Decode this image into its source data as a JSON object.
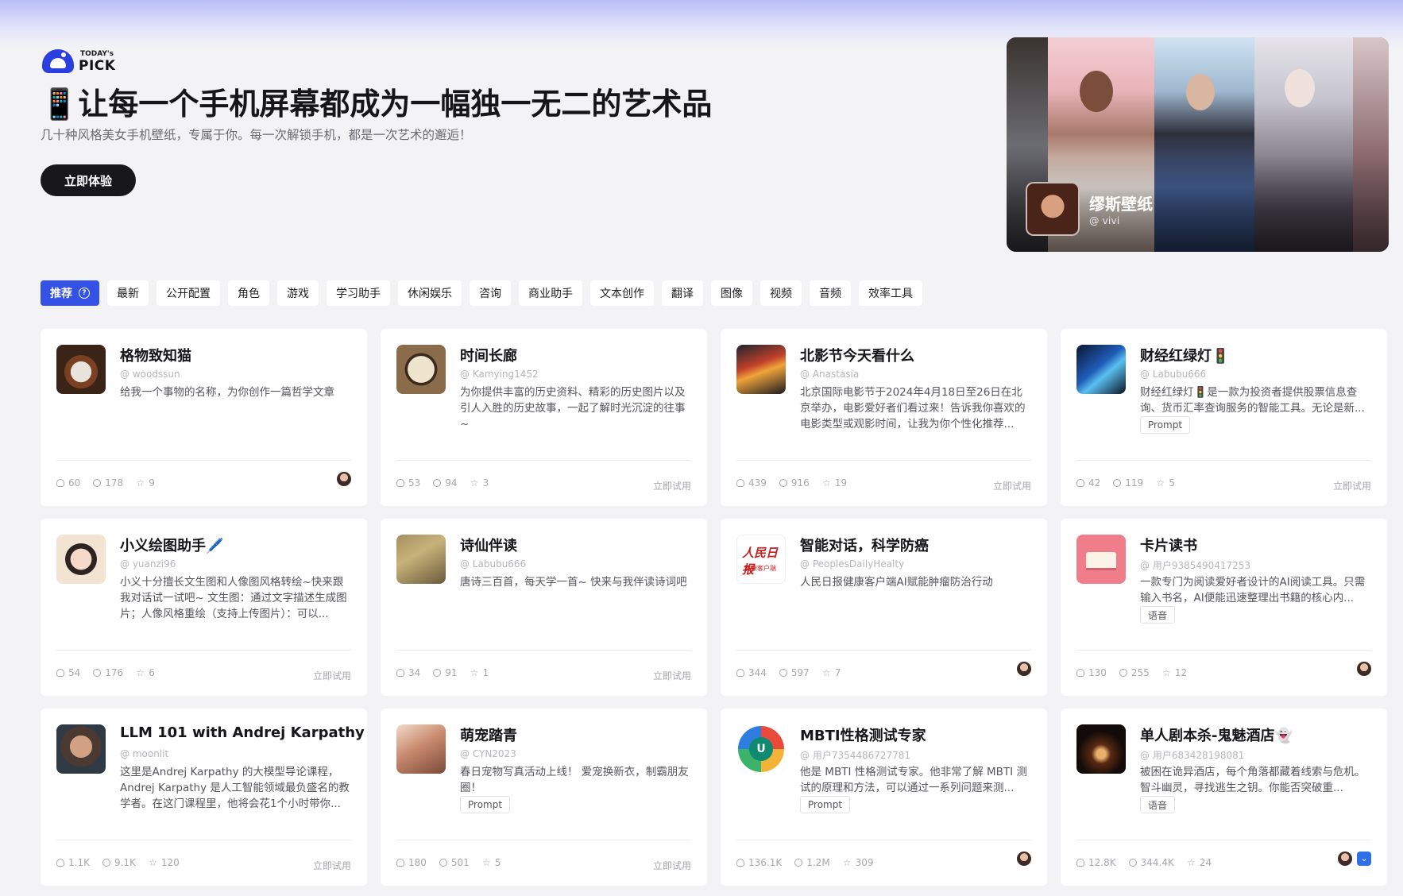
{
  "brand": {
    "logo_line1": "TODAY's",
    "logo_line2": "PICK"
  },
  "hero": {
    "title": "📱让每一个手机屏幕都成为一幅独一无二的艺术品",
    "subtitle": "几十种风格美女手机壁纸，专属于你。每一次解锁手机，都是一次艺术的邂逅！",
    "cta": "立即体验"
  },
  "banner": {
    "title": "缪斯壁纸",
    "author": "@ vivi"
  },
  "tabs": [
    "推荐",
    "最新",
    "公开配置",
    "角色",
    "游戏",
    "学习助手",
    "休闲娱乐",
    "咨询",
    "商业助手",
    "文本创作",
    "翻译",
    "图像",
    "视频",
    "音频",
    "效率工具"
  ],
  "try_label": "立即试用",
  "cards": [
    {
      "title": "格物致知猫",
      "author": "@ woodssun",
      "desc": "给我一个事物的名称，为你创作一篇哲学文章",
      "users": "60",
      "comments": "178",
      "stars": "9",
      "thumb_icon": "cat-icon"
    },
    {
      "title": "时间长廊",
      "author": "@ Kamying1452",
      "desc": "为你提供丰富的历史资料、精彩的历史图片以及引人入胜的历史故事，一起了解时光沉淀的往事~",
      "users": "53",
      "comments": "94",
      "stars": "3",
      "thumb_icon": "clock-icon"
    },
    {
      "title": "北影节今天看什么",
      "author": "@ Anastasia",
      "desc": "北京国际电影节于2024年4月18日至26日在北京举办，电影爱好者们看过来！告诉我你喜欢的电影类型或观影时间，让我为你个性化推荐...",
      "users": "439",
      "comments": "916",
      "stars": "19",
      "thumb_icon": "film-icon"
    },
    {
      "title": "财经红绿灯🚦",
      "author": "@ Labubu666",
      "desc": "财经红绿灯🚦是一款为投资者提供股票信息查询、货币汇率查询服务的智能工具。无论是新...",
      "tag": "Prompt",
      "users": "42",
      "comments": "119",
      "stars": "5",
      "thumb_icon": "finance-icon"
    },
    {
      "title": "小义绘图助手🖊️",
      "author": "@ yuanzi96",
      "desc": "小义十分擅长文生图和人像图风格转绘~快来跟我对话试一试吧~ 文生图：通过文字描述生成图片；人像风格重绘（支持上传图片）：可以...",
      "users": "54",
      "comments": "176",
      "stars": "6",
      "thumb_icon": "girl-icon"
    },
    {
      "title": "诗仙伴读",
      "author": "@ Labubu666",
      "desc": "唐诗三百首，每天学一首~ 快来与我伴读诗词吧",
      "users": "34",
      "comments": "91",
      "stars": "1",
      "thumb_icon": "poet-icon"
    },
    {
      "title": "智能对话，科学防癌",
      "author": "@ PeoplesDailyHealty",
      "desc": "人民日报健康客户端AI赋能肿瘤防治行动",
      "users": "344",
      "comments": "597",
      "stars": "7",
      "thumb_icon": "rmrb-logo-icon",
      "thumb_text1": "人民日报",
      "thumb_text2": "健康客户端"
    },
    {
      "title": "卡片读书",
      "author": "@ 用户9385490417253",
      "desc": "一款专门为阅读爱好者设计的AI阅读工具。只需输入书名，AI便能迅速整理出书籍的核心内...",
      "tag": "语音",
      "users": "130",
      "comments": "255",
      "stars": "12",
      "thumb_icon": "book-icon"
    },
    {
      "title": "LLM 101 with Andrej Karpathy",
      "author": "@ moonlit",
      "desc": "这里是Andrej Karpathy 的大模型导论课程，Andrej Karpathy 是人工智能领域最负盛名的教学者。在这门课程里，他将会花1个小时带你...",
      "users": "1.1K",
      "comments": "9.1K",
      "stars": "120",
      "thumb_icon": "karpathy-icon"
    },
    {
      "title": "萌宠踏青",
      "author": "@ CYN2023",
      "desc": "春日宠物写真活动上线！ 爱宠换新衣，制霸朋友圈！",
      "tag": "Prompt",
      "users": "180",
      "comments": "501",
      "stars": "5",
      "thumb_icon": "pet-icon"
    },
    {
      "title": "MBTI性格测试专家",
      "author": "@ 用户7354486727781",
      "desc": "他是 MBTI 性格测试专家。他非常了解 MBTI 测试的原理和方法，可以通过一系列问题来测...",
      "tag": "Prompt",
      "users": "136.1K",
      "comments": "1.2M",
      "stars": "309",
      "thumb_icon": "mbti-icon",
      "thumb_text1": "U"
    },
    {
      "title": "单人剧本杀-鬼魅酒店👻",
      "author": "@ 用户6834281980​81",
      "desc": "被困在诡异酒店，每个角落都藏着线索与危机。智斗幽灵，寻找逃生之钥。你能否突破重...",
      "tag": "语音",
      "users": "12.8K",
      "comments": "344.4K",
      "stars": "24",
      "thumb_icon": "hotel-icon"
    }
  ]
}
